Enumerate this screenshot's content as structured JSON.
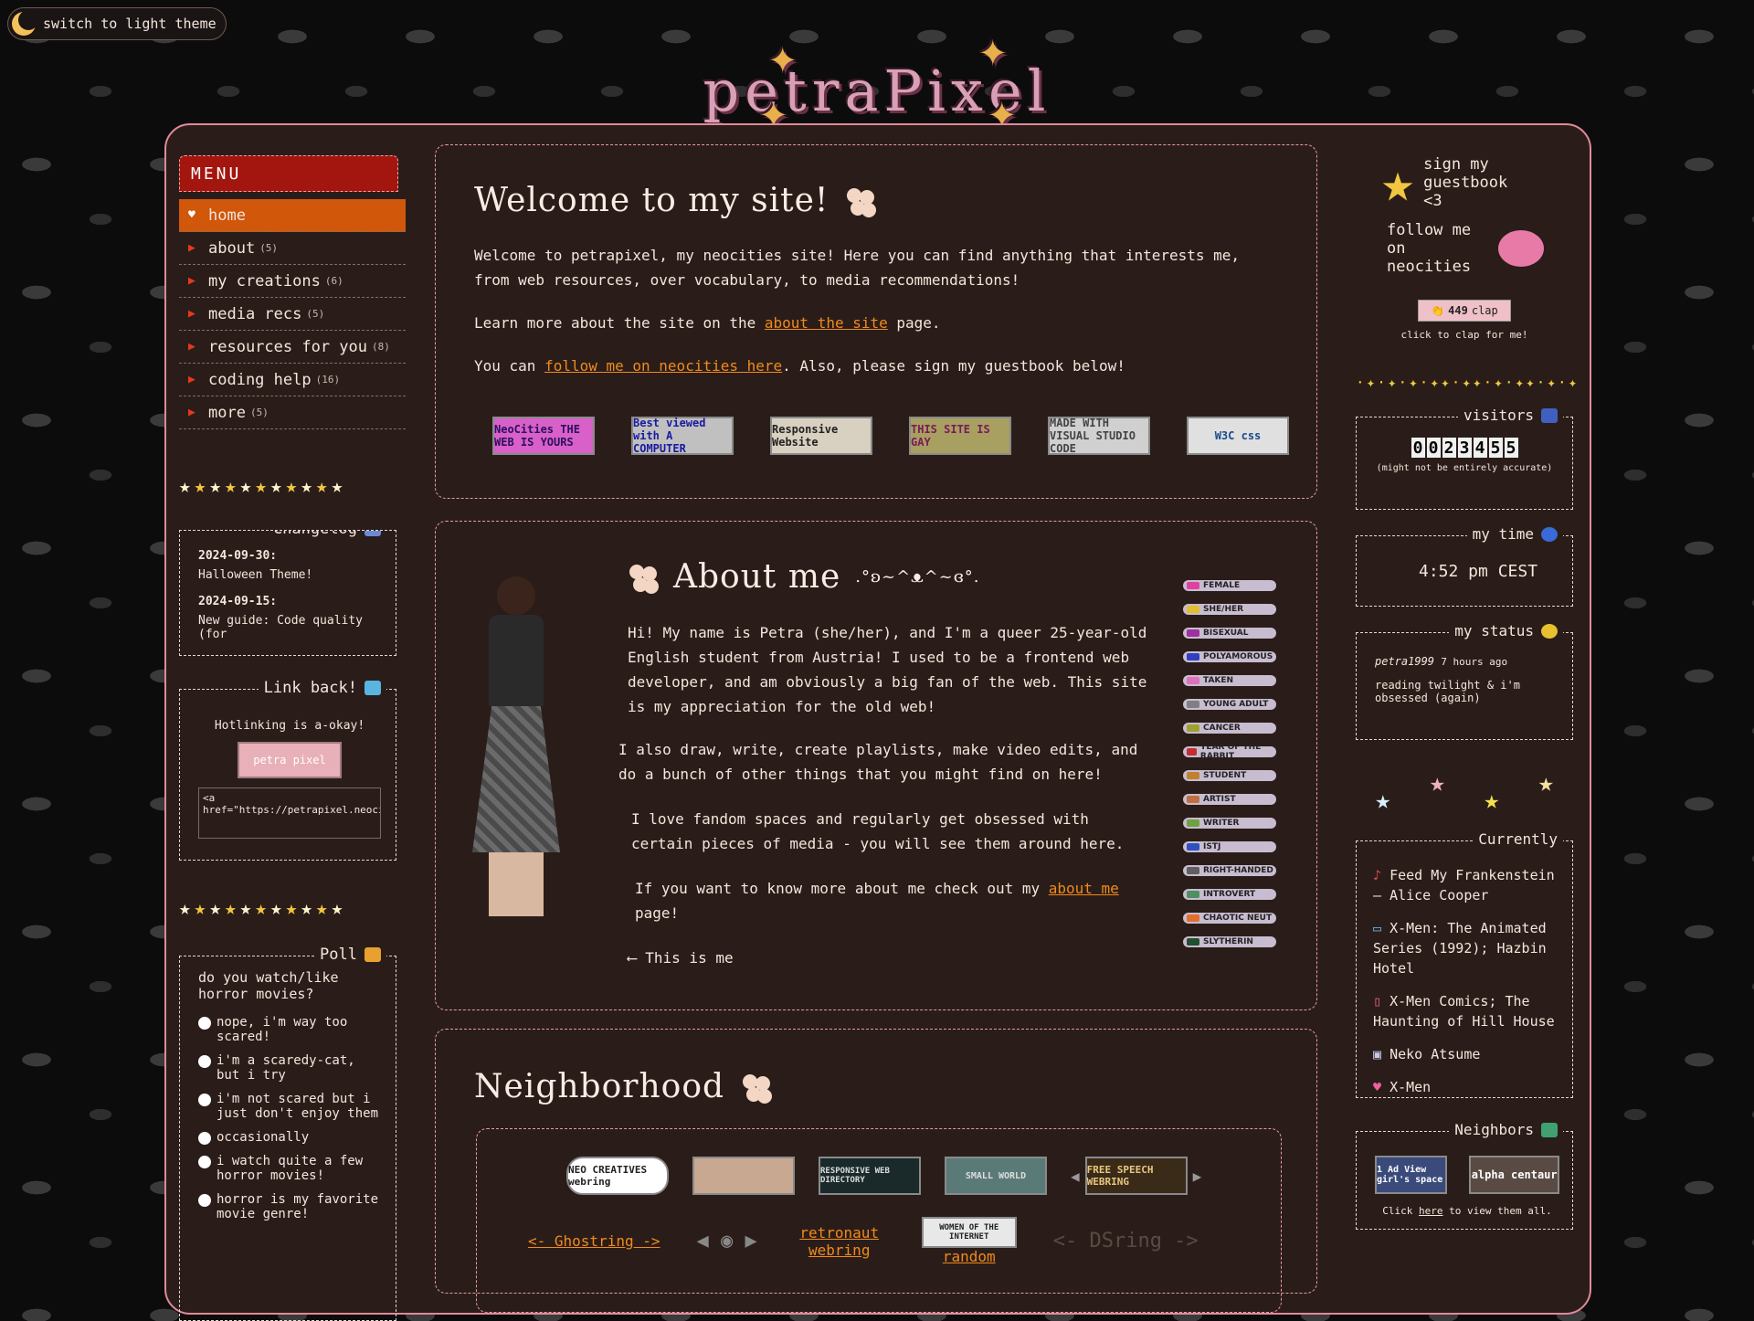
{
  "theme_toggle": "switch to light theme",
  "logo": "petraPixel",
  "menu": {
    "title": "MENU",
    "items": [
      {
        "label": "home",
        "count": ""
      },
      {
        "label": "about",
        "count": "(5)"
      },
      {
        "label": "my creations",
        "count": "(6)"
      },
      {
        "label": "media recs",
        "count": "(5)"
      },
      {
        "label": "resources for you",
        "count": "(8)"
      },
      {
        "label": "coding help",
        "count": "(16)"
      },
      {
        "label": "more",
        "count": "(5)"
      }
    ]
  },
  "changelog": {
    "title": "Changelog",
    "entries": [
      {
        "date": "2024-09-30:",
        "text": "Halloween Theme!"
      },
      {
        "date": "2024-09-15:",
        "text": "New guide: Code quality (for"
      }
    ]
  },
  "linkback": {
    "title": "Link back!",
    "note": "Hotlinking is a-okay!",
    "button": "petra pixel",
    "code": "<a href=\"https://petrapixel.neocities.org/\""
  },
  "poll": {
    "title": "Poll",
    "question": "do you watch/like horror movies?",
    "options": [
      "nope, i'm way too scared!",
      "i'm a scaredy-cat, but i try",
      "i'm not scared but i just don't enjoy them",
      "occasionally",
      "i watch quite a few horror movies!",
      "horror is my favorite movie genre!"
    ]
  },
  "welcome": {
    "title": "Welcome to my site!",
    "p1": "Welcome to petrapixel, my neocities site! Here you can find anything that interests me, from web resources, over vocabulary, to media recommendations!",
    "p2_pre": "Learn more about the site on the ",
    "p2_link": "about the site",
    "p2_post": " page.",
    "p3_pre": "You can ",
    "p3_link": "follow me on neocities here",
    "p3_post": ". Also, please sign my guestbook below!",
    "badges": [
      "NeoCities THE WEB IS YOURS",
      "Best viewed with A COMPUTER",
      "Responsive Website",
      "THIS SITE IS GAY",
      "MADE WITH VISUAL STUDIO CODE",
      "W3C css"
    ]
  },
  "about": {
    "title": "About me",
    "kaomoji": ".°ʚ~^ᴥ^~ɞ°.",
    "p1": "Hi! My name is Petra (she/her), and I'm a queer 25-year-old English student from Austria! I used to be a frontend web developer, and am obviously a big fan of the web. This site is my appreciation for the old web!",
    "p2": "I also draw, write, create playlists, make video edits, and do a bunch of other things that you might find on here!",
    "p3": "I love fandom spaces and regularly get obsessed with certain pieces of media - you will see them around here.",
    "p4_pre": "If you want to know more about me check out my ",
    "p4_link": "about me",
    "p4_post": " page!",
    "caption": "⟵ This is me",
    "tags": [
      "FEMALE",
      "SHE/HER",
      "BISEXUAL",
      "POLYAMOROUS",
      "TAKEN",
      "YOUNG ADULT",
      "CANCER",
      "YEAR OF THE RABBIT",
      "STUDENT",
      "ARTIST",
      "WRITER",
      "ISTJ",
      "RIGHT-HANDED",
      "INTROVERT",
      "CHAOTIC NEUT",
      "SLYTHERIN"
    ]
  },
  "neighborhood": {
    "title": "Neighborhood",
    "webrings": [
      "NEO CREATIVES webring",
      "",
      "RESPONSIVE WEB DIRECTORY",
      "SMALL WORLD",
      "FREE SPEECH WEBRING"
    ],
    "links": {
      "ghost": "<- Ghostring ->",
      "retronaut": "retronaut webring",
      "woman": "WOMEN OF THE INTERNET",
      "random": "random",
      "dsring": "<- DSring ->"
    }
  },
  "right": {
    "guestbook": "sign my guestbook <3",
    "follow": "follow me on neocities",
    "clap_count": "449",
    "clap_label": "clap",
    "clap_note": "click to clap for me!",
    "visitors_title": "visitors",
    "visitor_digits": [
      "0",
      "0",
      "2",
      "3",
      "4",
      "5",
      "5"
    ],
    "visitors_note": "(might not be entirely accurate)",
    "time_title": "my time",
    "time": "4:52 pm CEST",
    "status_title": "my status",
    "status_user": "petra1999",
    "status_ago": "7 hours ago",
    "status_text": "reading twilight & i'm obsessed (again)",
    "currently_title": "Currently",
    "currently": [
      "Feed My Frankenstein – Alice Cooper",
      "X-Men: The Animated Series (1992); Hazbin Hotel",
      "X-Men Comics; The Haunting of Hill House",
      "Neko Atsume",
      "X-Men"
    ],
    "neighbors_title": "Neighbors",
    "neighbors": [
      "1 Ad View girl's space",
      "alpha centaur"
    ],
    "neighbors_pre": "Click ",
    "neighbors_link": "here",
    "neighbors_post": " to view them all."
  }
}
